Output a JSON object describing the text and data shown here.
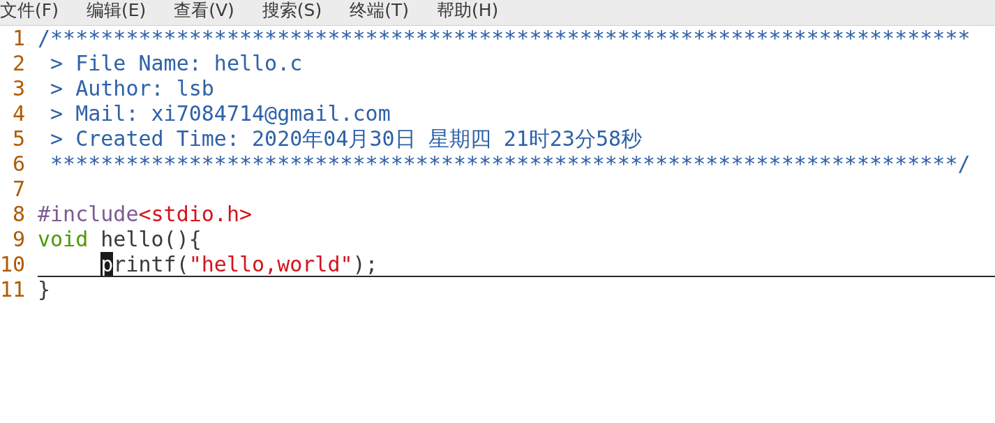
{
  "menu": [
    "文件(F)",
    "编辑(E)",
    "查看(V)",
    "搜索(S)",
    "终端(T)",
    "帮助(H)"
  ],
  "lines": [
    {
      "number": "1",
      "current": false,
      "segments": [
        {
          "kind": "comment",
          "text": "/*************************************************************************"
        }
      ]
    },
    {
      "number": "2",
      "current": false,
      "segments": [
        {
          "kind": "comment",
          "text": " > File Name: hello.c"
        }
      ]
    },
    {
      "number": "3",
      "current": false,
      "segments": [
        {
          "kind": "comment",
          "text": " > Author: lsb"
        }
      ]
    },
    {
      "number": "4",
      "current": false,
      "segments": [
        {
          "kind": "comment",
          "text": " > Mail: xi7084714@gmail.com"
        }
      ]
    },
    {
      "number": "5",
      "current": false,
      "segments": [
        {
          "kind": "comment",
          "text": " > Created Time: 2020年04月30日 星期四 21时23分58秒"
        }
      ]
    },
    {
      "number": "6",
      "current": false,
      "segments": [
        {
          "kind": "comment",
          "text": " ************************************************************************/"
        }
      ]
    },
    {
      "number": "7",
      "current": false
    },
    {
      "number": "8",
      "current": false,
      "segments": [
        {
          "kind": "preproc",
          "text": "#include"
        },
        {
          "kind": "header",
          "text": "<stdio.h>"
        }
      ]
    },
    {
      "number": "9",
      "current": false,
      "segments": [
        {
          "kind": "type",
          "text": "void"
        },
        {
          "kind": "plain",
          "text": " hello(){"
        }
      ]
    },
    {
      "number": "10",
      "current": true,
      "segments": [
        {
          "kind": "plain",
          "text": "p",
          "cursor": true,
          "indented": true
        },
        {
          "kind": "plain",
          "text": "rintf("
        },
        {
          "kind": "string",
          "text": "\"hello,world\""
        },
        {
          "kind": "plain",
          "text": ");"
        }
      ]
    },
    {
      "number": "11",
      "current": false,
      "segments": [
        {
          "kind": "plain",
          "text": "}"
        }
      ]
    }
  ]
}
